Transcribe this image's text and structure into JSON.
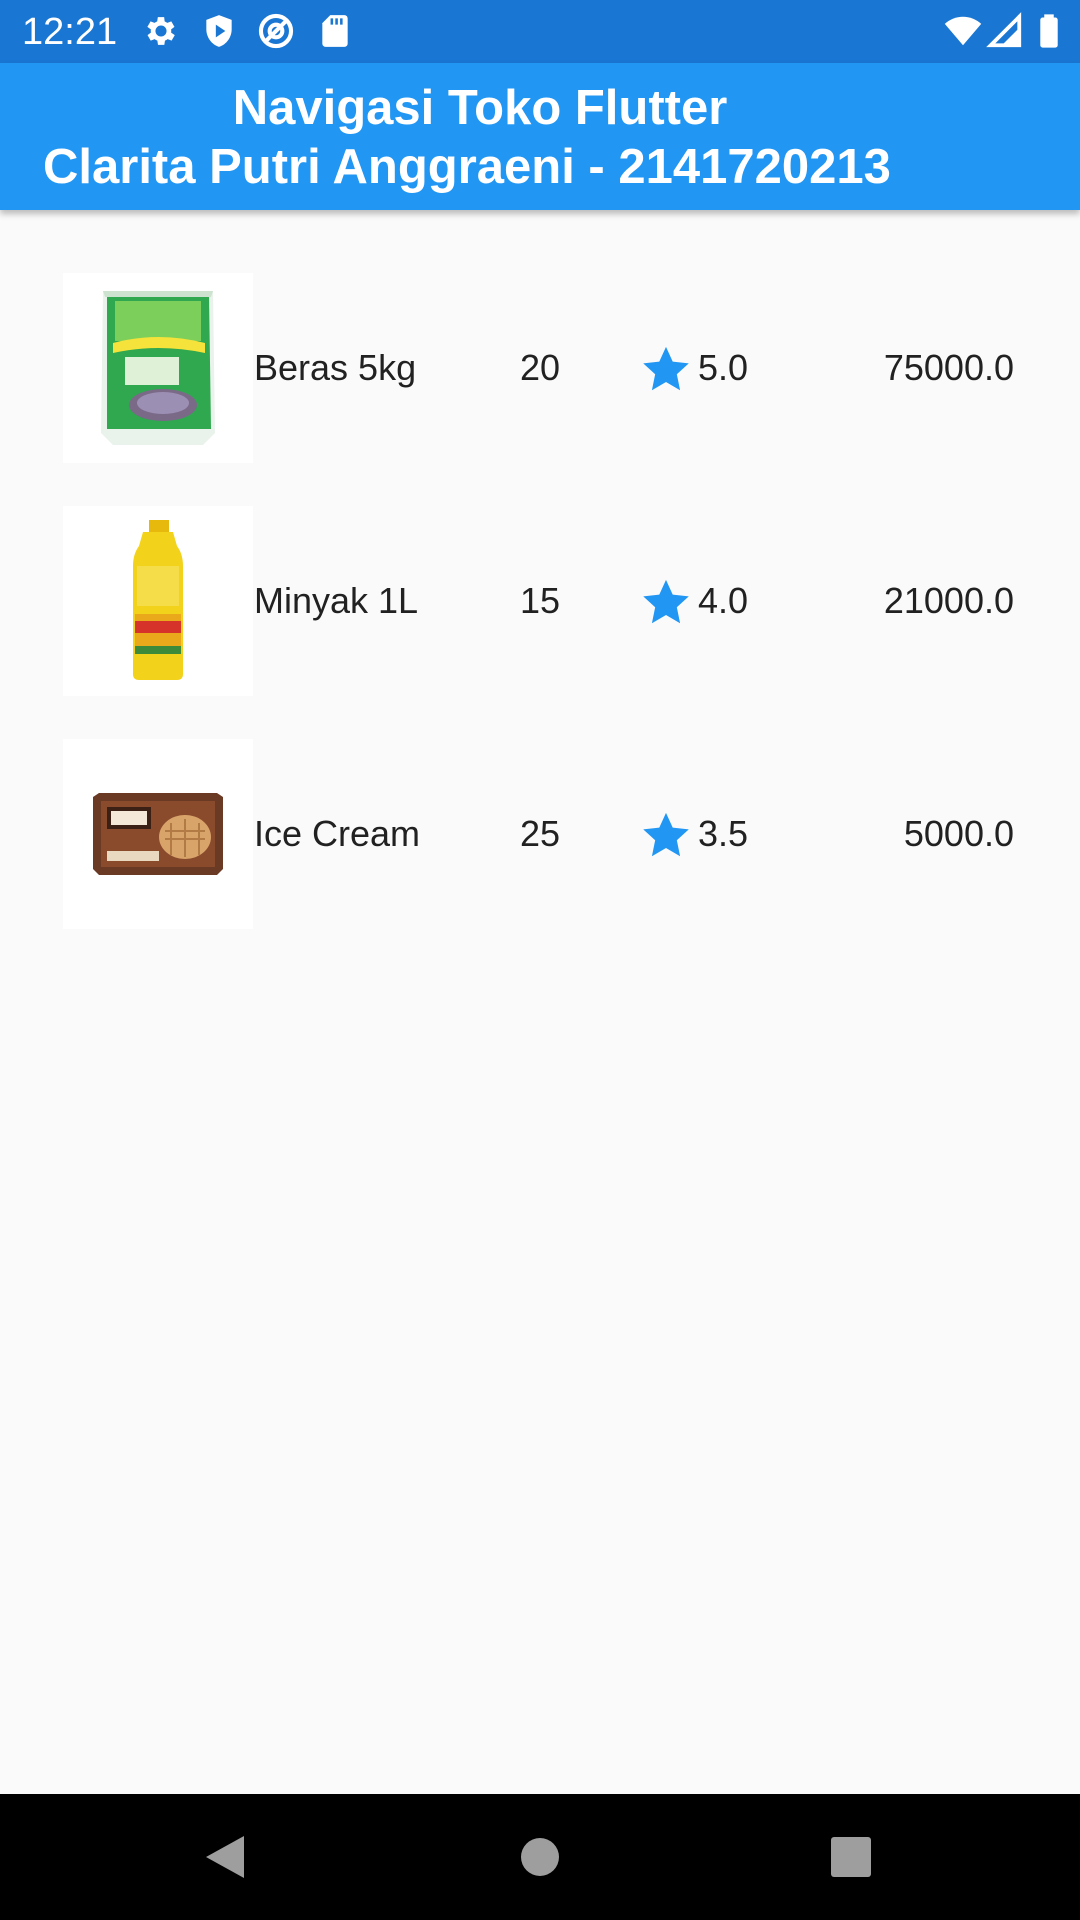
{
  "status_bar": {
    "time": "12:21",
    "icons": [
      "gear-icon",
      "shield-play-icon",
      "at-sign-icon",
      "sd-card-icon",
      "wifi-icon",
      "signal-icon",
      "battery-icon"
    ]
  },
  "app_bar": {
    "title_line1": "Navigasi Toko Flutter",
    "title_line2": "Clarita Putri Anggraeni - 2141720213"
  },
  "products": [
    {
      "name": "Beras 5kg",
      "stock": "20",
      "rating": "5.0",
      "price": "75000.0",
      "image": "rice-bag-image"
    },
    {
      "name": "Minyak 1L",
      "stock": "15",
      "rating": "4.0",
      "price": "21000.0",
      "image": "oil-bottle-image"
    },
    {
      "name": "Ice Cream",
      "stock": "25",
      "rating": "3.5",
      "price": "5000.0",
      "image": "ice-cream-image"
    }
  ],
  "colors": {
    "status_bar": "#1976d2",
    "app_bar": "#2196f3",
    "star": "#2196f3",
    "background": "#fafafa"
  },
  "nav_bar": {
    "buttons": [
      "back-icon",
      "home-icon",
      "recents-icon"
    ]
  }
}
